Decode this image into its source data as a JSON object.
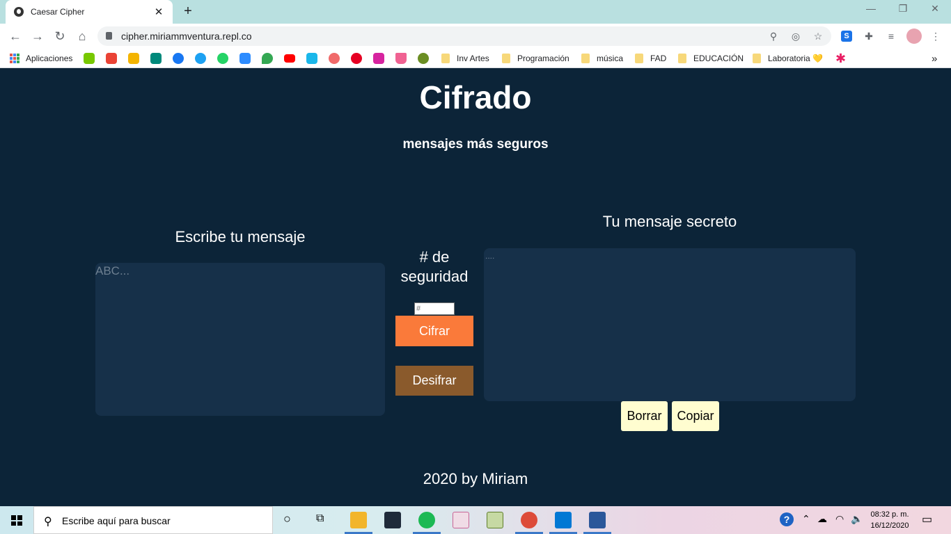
{
  "browser": {
    "tab_title": "Caesar Cipher",
    "tab_close": "✕",
    "new_tab": "+",
    "window_controls": [
      "—",
      "❐",
      "✕"
    ],
    "url": "cipher.miriammventura.repl.co",
    "bookmarks": {
      "apps_label": "Aplicaciones",
      "folders": [
        "Inv Artes",
        "Programación",
        "música",
        "FAD",
        "EDUCACIÓN",
        "Laboratoria 💛"
      ],
      "overflow": "»"
    }
  },
  "page": {
    "title": "Cifrado",
    "subtitle": "mensajes más seguros",
    "input_label": "Escribe tu mensaje",
    "input_placeholder": "ABC...",
    "output_label": "Tu mensaje secreto",
    "output_placeholder": "....",
    "offset_label": "# de seguridad",
    "offset_placeholder": "#",
    "cifrar_label": "Cifrar",
    "desifrar_label": "Desifrar",
    "borrar_label": "Borrar",
    "copiar_label": "Copiar",
    "footer": "2020 by Miriam"
  },
  "taskbar": {
    "search_placeholder": "Escribe aquí para buscar",
    "time": "08:32 p. m.",
    "date": "16/12/2020"
  },
  "colors": {
    "page_background": "#0c2438",
    "textarea_background": "#163049",
    "cifrar_button": "#fa7a3a",
    "desifrar_button": "#8a5a2c",
    "light_button": "#fffdd0"
  }
}
